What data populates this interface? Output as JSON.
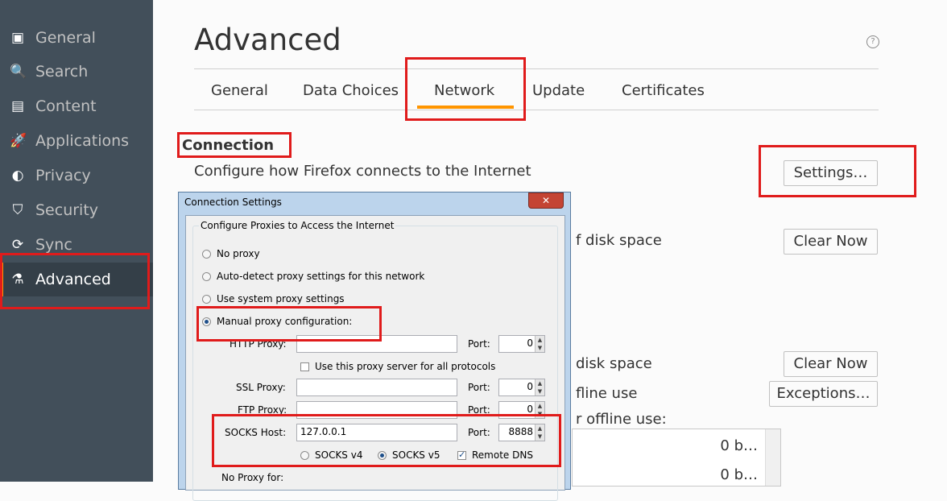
{
  "sidebar": {
    "items": [
      {
        "label": "General",
        "icon": "general-icon",
        "glyph": "▣"
      },
      {
        "label": "Search",
        "icon": "search-icon",
        "glyph": "🔍"
      },
      {
        "label": "Content",
        "icon": "content-icon",
        "glyph": "▤"
      },
      {
        "label": "Applications",
        "icon": "applications-icon",
        "glyph": "🚀"
      },
      {
        "label": "Privacy",
        "icon": "privacy-icon",
        "glyph": "◐"
      },
      {
        "label": "Security",
        "icon": "security-icon",
        "glyph": "⛉"
      },
      {
        "label": "Sync",
        "icon": "sync-icon",
        "glyph": "⟳"
      },
      {
        "label": "Advanced",
        "icon": "advanced-icon",
        "glyph": "⚗"
      }
    ]
  },
  "page": {
    "title": "Advanced",
    "help_glyph": "?",
    "tabs": [
      "General",
      "Data Choices",
      "Network",
      "Update",
      "Certificates"
    ],
    "active_tab": "Network",
    "connection_heading": "Connection",
    "connection_desc": "Configure how Firefox connects to the Internet",
    "settings_button": "Settings…",
    "clear_now_1": "Clear Now",
    "disk_space_1": "f disk space",
    "disk_space_2": "disk space",
    "clear_now_2": "Clear Now",
    "offline_use": "fline use",
    "exceptions_button": "Exceptions…",
    "offline_use_2": "r offline use:",
    "list_values": [
      "0 b…",
      "0 b…"
    ]
  },
  "dialog": {
    "title": "Connection Settings",
    "close_glyph": "✕",
    "group_legend": "Configure Proxies to Access the Internet",
    "options": [
      "No proxy",
      "Auto-detect proxy settings for this network",
      "Use system proxy settings",
      "Manual proxy configuration:"
    ],
    "selected_option": "Manual proxy configuration:",
    "http_label": "HTTP Proxy:",
    "http_value": "",
    "http_port_label": "Port:",
    "http_port": "0",
    "use_for_all_label": "Use this proxy server for all protocols",
    "use_for_all_checked": false,
    "ssl_label": "SSL Proxy:",
    "ssl_port_label": "Port:",
    "ssl_port": "0",
    "ftp_label": "FTP Proxy:",
    "ftp_port_label": "Port:",
    "ftp_port": "0",
    "socks_label": "SOCKS Host:",
    "socks_value": "127.0.0.1",
    "socks_port_label": "Port:",
    "socks_port": "8888",
    "socks_v4": "SOCKS v4",
    "socks_v5": "SOCKS v5",
    "socks_version_selected": "SOCKS v5",
    "remote_dns": "Remote DNS",
    "remote_dns_checked": true,
    "no_proxy_label": "No Proxy for:"
  },
  "colors": {
    "sidebar_bg": "#424f5a",
    "accent": "#ff9500",
    "highlight_red": "#e01b1b"
  }
}
